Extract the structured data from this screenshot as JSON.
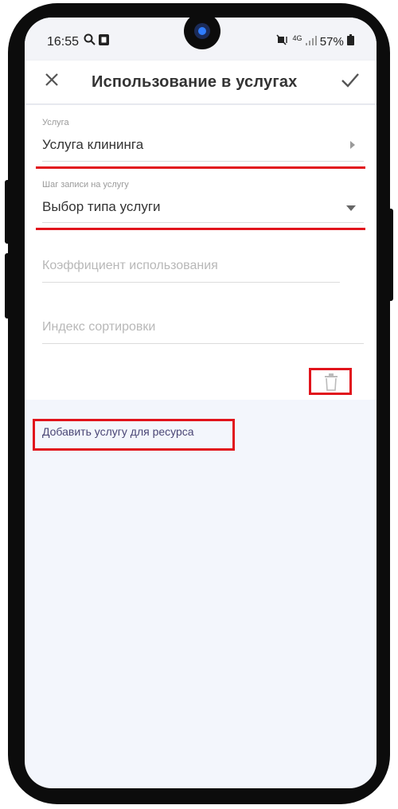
{
  "status_bar": {
    "time": "16:55",
    "left_icons": [
      "search-icon",
      "image-icon"
    ],
    "signal_text": "4G",
    "battery": "57%",
    "right_icons": [
      "mute-vibrate-icon",
      "signal-icon",
      "battery-icon"
    ]
  },
  "appbar": {
    "title": "Использование в услугах",
    "close_icon": "close-icon",
    "confirm_icon": "check-icon"
  },
  "form": {
    "service": {
      "label": "Услуга",
      "value": "Услуга клининга"
    },
    "step": {
      "label": "Шаг записи на услугу",
      "value": "Выбор типа услуги"
    },
    "coefficient": {
      "placeholder": "Коэффициент использования"
    },
    "sort_index": {
      "placeholder": "Индекс сортировки"
    },
    "delete_icon": "trash-icon"
  },
  "add_link": "Добавить услугу для ресурса",
  "colors": {
    "highlight": "#e1141c",
    "background": "#f3f6fc",
    "link": "#4a4675"
  }
}
